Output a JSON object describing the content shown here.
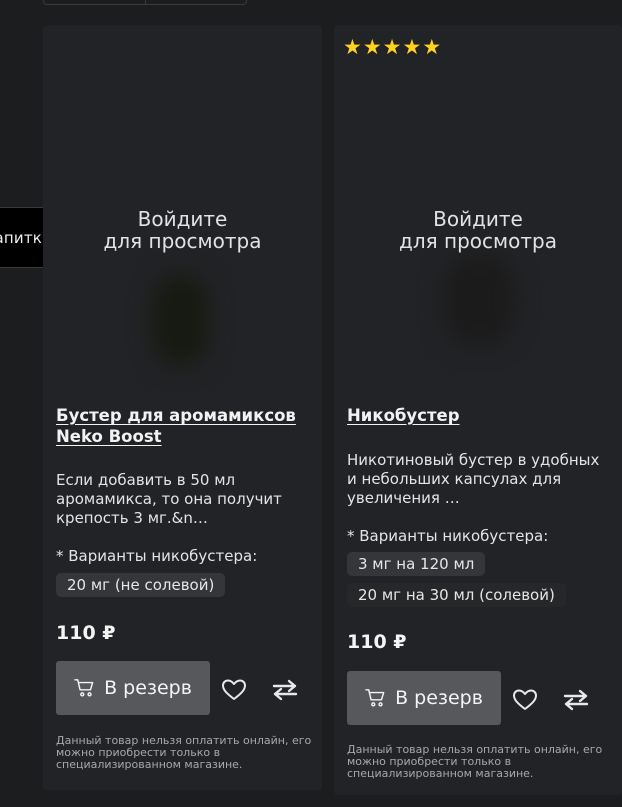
{
  "side_chip": {
    "label": "апитки"
  },
  "products": [
    {
      "rating_stars": 0,
      "login_overlay_line1": "Войдите",
      "login_overlay_line2": "для просмотра",
      "title": "Бустер для аромамиксов Neko Boost",
      "description": "Если добавить в 50 мл аромамикса, то она получит крепость 3 мг.&n…",
      "variants_label": "* Варианты никобустера:",
      "variants": [
        "20 мг (не солевой)"
      ],
      "price": "110 ₽",
      "reserve_label": "В резерв",
      "note": "Данный товар нельзя оплатить онлайн, его можно приобрести только в специализированном магазине."
    },
    {
      "rating_stars": 5,
      "login_overlay_line1": "Войдите",
      "login_overlay_line2": "для просмотра",
      "title": "Никобустер",
      "description": "Никотиновый бустер в удобных и небольших капсулах для увеличения …",
      "variants_label": "* Варианты никобустера:",
      "variants": [
        "3 мг на 120 мл",
        "20 мг на 30 мл (солевой)"
      ],
      "price": "110 ₽",
      "reserve_label": "В резерв",
      "note": "Данный товар нельзя оплатить онлайн, его можно приобрести только в специализированном магазине."
    }
  ],
  "icons": {
    "cart": "cart-icon",
    "favorite": "heart-icon",
    "compare": "compare-arrows-icon",
    "star": "star-icon"
  },
  "colors": {
    "background": "#1c1d1f",
    "card": "#222326",
    "button": "#56585c",
    "star": "#ffd21f"
  }
}
